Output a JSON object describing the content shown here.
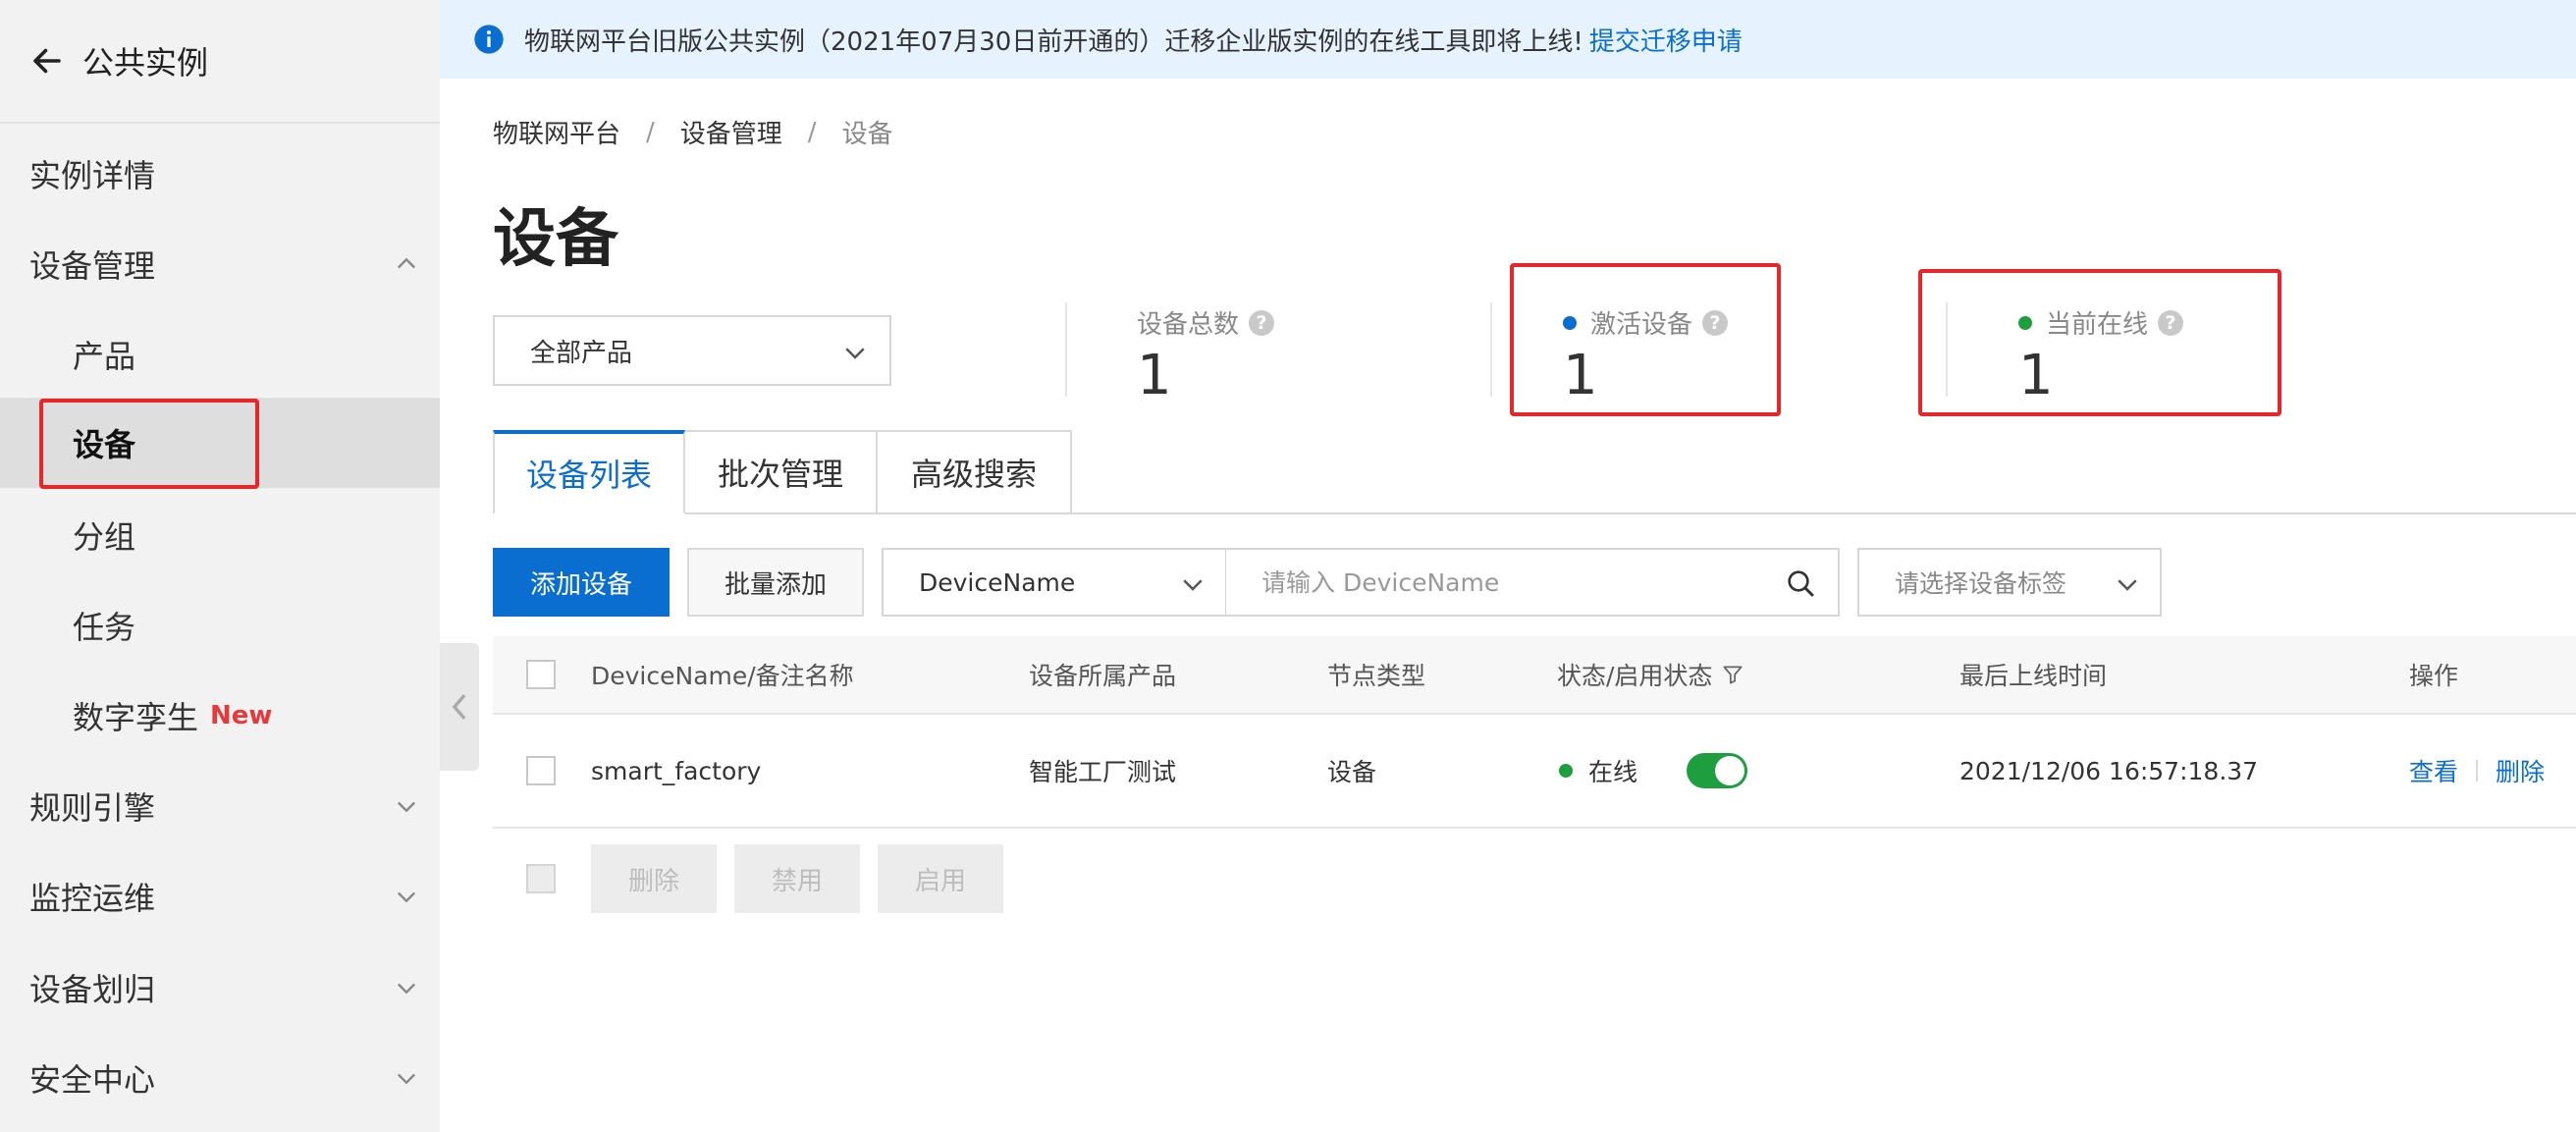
{
  "sidebar": {
    "title": "公共实例",
    "items": [
      {
        "label": "实例详情"
      },
      {
        "label": "设备管理"
      },
      {
        "label": "产品"
      },
      {
        "label": "设备"
      },
      {
        "label": "分组"
      },
      {
        "label": "任务"
      },
      {
        "label": "数字孪生",
        "tag": "New"
      },
      {
        "label": "规则引擎"
      },
      {
        "label": "监控运维"
      },
      {
        "label": "设备划归"
      },
      {
        "label": "安全中心"
      }
    ]
  },
  "notice": {
    "text": "物联网平台旧版公共实例（2021年07月30日前开通的）迁移企业版实例的在线工具即将上线!",
    "link": "提交迁移申请"
  },
  "breadcrumb": [
    "物联网平台",
    "设备管理",
    "设备"
  ],
  "breadcrumb_sep": "/",
  "page_title": "设备",
  "product_select": {
    "value": "全部产品"
  },
  "stats": {
    "total": {
      "label": "设备总数",
      "value": "1"
    },
    "activated": {
      "label": "激活设备",
      "value": "1",
      "dot_color": "#0a6ed1"
    },
    "online": {
      "label": "当前在线",
      "value": "1",
      "dot_color": "#1e9e3e"
    },
    "help_symbol": "?"
  },
  "tabs": [
    "设备列表",
    "批次管理",
    "高级搜索"
  ],
  "toolbar": {
    "add_label": "添加设备",
    "batch_label": "批量添加",
    "field_select": "DeviceName",
    "search_placeholder": "请输入 DeviceName",
    "tag_placeholder": "请选择设备标签"
  },
  "table": {
    "headers": [
      "DeviceName/备注名称",
      "设备所属产品",
      "节点类型",
      "状态/启用状态",
      "最后上线时间",
      "操作"
    ],
    "rows": [
      {
        "name": "smart_factory",
        "product": "智能工厂测试",
        "node_type": "设备",
        "status": "在线",
        "enabled": true,
        "last_online": "2021/12/06 16:57:18.37",
        "actions": [
          "查看",
          "删除"
        ]
      }
    ]
  },
  "bulk_actions": [
    "删除",
    "禁用",
    "启用"
  ],
  "colors": {
    "primary": "#0a6ed1",
    "online": "#1e9e3e",
    "highlight": "#e8262a"
  }
}
